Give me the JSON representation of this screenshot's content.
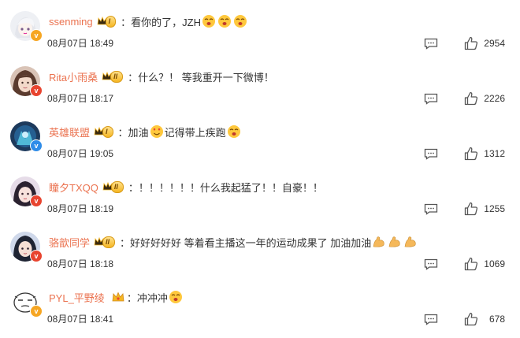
{
  "comments": [
    {
      "username": "ssenming",
      "level": "I",
      "separator": "：",
      "text": "看你的了，JZH",
      "emojis": [
        "cheer-face",
        "cheer-face",
        "cheer-face"
      ],
      "time": "08月07日 18:49",
      "likes": "2954",
      "verified_color": "#f6a623"
    },
    {
      "username": "Rita小雨桑",
      "level": "II",
      "separator": "：",
      "text": "什么？！ 等我重开一下微博！",
      "emojis": [],
      "time": "08月07日 18:17",
      "likes": "2226",
      "verified_color": "#e8442f"
    },
    {
      "username": "英雄联盟",
      "level": "I",
      "separator": "：",
      "text": "加油",
      "text_after": "记得带上疾跑",
      "emojis": [
        "love-face"
      ],
      "emojis_after": [
        "cheer-face"
      ],
      "time": "08月07日 19:05",
      "likes": "1312",
      "verified_color": "#2f8ce8"
    },
    {
      "username": "瞳夕TXQQ",
      "level": "II",
      "separator": "：",
      "text": "！！！！！！什么我起猛了！！自豪！！",
      "emojis": [],
      "time": "08月07日 18:19",
      "likes": "1255",
      "verified_color": "#e8442f"
    },
    {
      "username": "骆歆同学",
      "level": "II",
      "separator": "：",
      "text": "好好好好好 等着看主播这一年的运动成果了 加油加油",
      "emojis": [
        "muscle-arm",
        "muscle-arm",
        "muscle-arm"
      ],
      "time": "08月07日 18:18",
      "likes": "1069",
      "verified_color": "#e8442f"
    },
    {
      "username": "PYL_平野绫",
      "level": "",
      "separator": "：",
      "text": "冲冲冲",
      "emojis": [
        "cheer-face"
      ],
      "time": "08月07日 18:41",
      "likes": "678",
      "verified_color": "#f6a623"
    }
  ]
}
